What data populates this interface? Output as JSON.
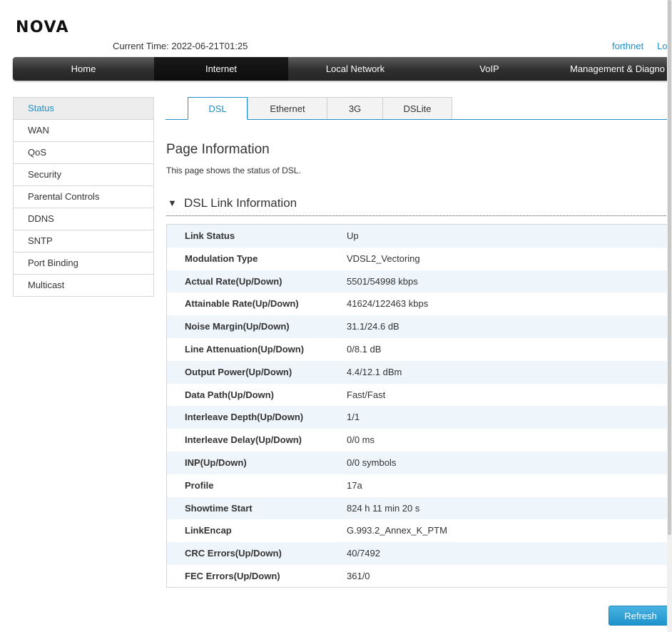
{
  "brand": {
    "logo": "NOVA"
  },
  "header": {
    "current_time": "Current Time: 2022-06-21T01:25",
    "user": "forthnet",
    "logout": "Lo"
  },
  "nav": {
    "items": [
      {
        "label": "Home"
      },
      {
        "label": "Internet"
      },
      {
        "label": "Local Network"
      },
      {
        "label": "VoIP"
      },
      {
        "label": "Management & Diagno"
      }
    ],
    "active": "Internet"
  },
  "sidebar": {
    "items": [
      {
        "label": "Status"
      },
      {
        "label": "WAN"
      },
      {
        "label": "QoS"
      },
      {
        "label": "Security"
      },
      {
        "label": "Parental Controls"
      },
      {
        "label": "DDNS"
      },
      {
        "label": "SNTP"
      },
      {
        "label": "Port Binding"
      },
      {
        "label": "Multicast"
      }
    ],
    "active": "Status"
  },
  "tabs": {
    "items": [
      {
        "label": "DSL"
      },
      {
        "label": "Ethernet"
      },
      {
        "label": "3G"
      },
      {
        "label": "DSLite"
      }
    ],
    "active": "DSL"
  },
  "page": {
    "title": "Page Information",
    "description": "This page shows the status of DSL."
  },
  "section": {
    "title": "DSL Link Information",
    "rows": [
      {
        "label": "Link Status",
        "value": "Up"
      },
      {
        "label": "Modulation Type",
        "value": "VDSL2_Vectoring"
      },
      {
        "label": "Actual Rate(Up/Down)",
        "value": "5501/54998 kbps"
      },
      {
        "label": "Attainable Rate(Up/Down)",
        "value": "41624/122463 kbps"
      },
      {
        "label": "Noise Margin(Up/Down)",
        "value": "31.1/24.6 dB"
      },
      {
        "label": "Line Attenuation(Up/Down)",
        "value": "0/8.1 dB"
      },
      {
        "label": "Output Power(Up/Down)",
        "value": "4.4/12.1 dBm"
      },
      {
        "label": "Data Path(Up/Down)",
        "value": "Fast/Fast"
      },
      {
        "label": "Interleave Depth(Up/Down)",
        "value": "1/1"
      },
      {
        "label": "Interleave Delay(Up/Down)",
        "value": "0/0 ms"
      },
      {
        "label": "INP(Up/Down)",
        "value": "0/0 symbols"
      },
      {
        "label": "Profile",
        "value": "17a"
      },
      {
        "label": "Showtime Start",
        "value": "824 h 11 min 20 s"
      },
      {
        "label": "LinkEncap",
        "value": "G.993.2_Annex_K_PTM"
      },
      {
        "label": "CRC Errors(Up/Down)",
        "value": "40/7492"
      },
      {
        "label": "FEC Errors(Up/Down)",
        "value": "361/0"
      }
    ]
  },
  "actions": {
    "refresh": "Refresh"
  },
  "colors": {
    "accent": "#1f8fc6",
    "nav_bg": "#2e2e2e",
    "row_alt": "#eef5fb"
  }
}
